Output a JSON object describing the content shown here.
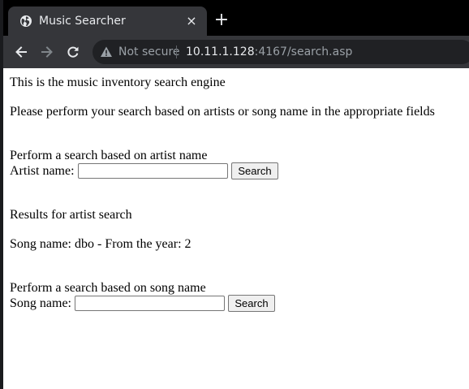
{
  "browser": {
    "tab": {
      "title": "Music Searcher",
      "close_glyph": "×",
      "icon": "globe-icon"
    },
    "new_tab_glyph": "+",
    "security_label": "Not secure",
    "url": {
      "host": "10.11.1.128",
      "rest": ":4167/search.asp"
    }
  },
  "page": {
    "intro": "This is the music inventory search engine",
    "instructions": "Please perform your search based on artists or song name in the appropriate fields",
    "artist_search": {
      "heading": "Perform a search based on artist name",
      "label": "Artist name:",
      "value": "",
      "button": "Search"
    },
    "results": {
      "heading": "Results for artist search",
      "row": "Song name: dbo - From the year: 2"
    },
    "song_search": {
      "heading": "Perform a search based on song name",
      "label": "Song name:",
      "value": "",
      "button": "Search"
    }
  },
  "colors": {
    "tabstrip": "#000000",
    "toolbar": "#35363a",
    "omnibox": "#202124",
    "page_bg": "#ffffff"
  }
}
